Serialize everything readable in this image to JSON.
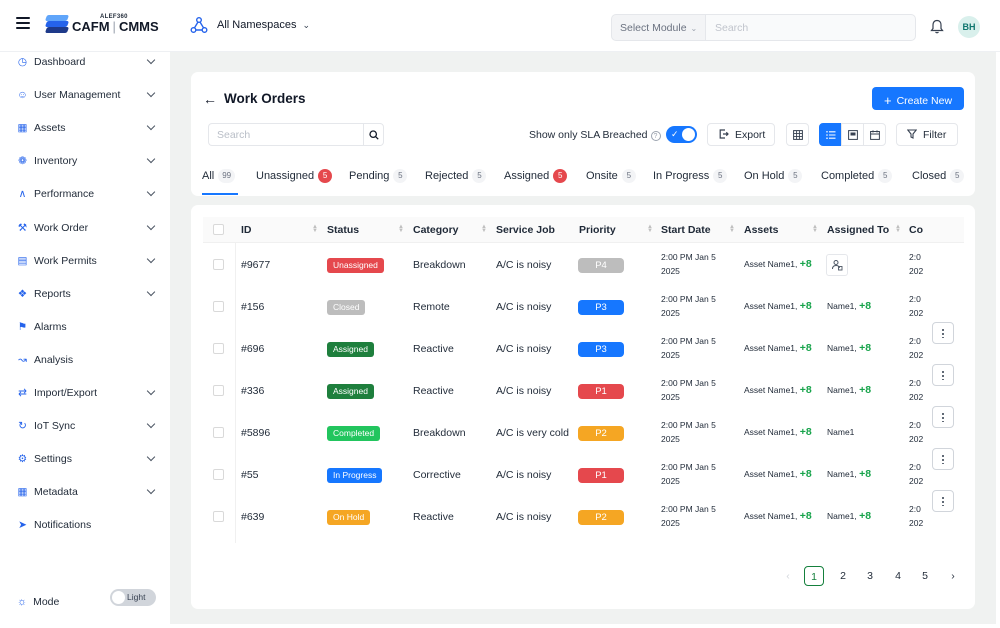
{
  "header": {
    "logo_small": "ALEF360",
    "logo_left": "CAFM",
    "logo_right": "CMMS",
    "namespace": "All Namespaces",
    "module_placeholder": "Select Module",
    "search_placeholder": "Search",
    "avatar": "BH"
  },
  "sidebar": {
    "items": [
      {
        "label": "Dashboard",
        "icon": "dashboard-icon",
        "chevron": true
      },
      {
        "label": "User Management",
        "icon": "user-icon",
        "chevron": true
      },
      {
        "label": "Assets",
        "icon": "grid-icon",
        "chevron": true
      },
      {
        "label": "Inventory",
        "icon": "inventory-icon",
        "chevron": true
      },
      {
        "label": "Performance",
        "icon": "performance-icon",
        "chevron": true
      },
      {
        "label": "Work Order",
        "icon": "tools-icon",
        "chevron": true
      },
      {
        "label": "Work Permits",
        "icon": "document-icon",
        "chevron": true
      },
      {
        "label": "Reports",
        "icon": "reports-icon",
        "chevron": true
      },
      {
        "label": "Alarms",
        "icon": "alarm-icon",
        "chevron": false
      },
      {
        "label": "Analysis",
        "icon": "analysis-icon",
        "chevron": false
      },
      {
        "label": "Import/Export",
        "icon": "import-export-icon",
        "chevron": true
      },
      {
        "label": "IoT Sync",
        "icon": "sync-icon",
        "chevron": true
      },
      {
        "label": "Settings",
        "icon": "gear-icon",
        "chevron": true
      },
      {
        "label": "Metadata",
        "icon": "metadata-icon",
        "chevron": true
      },
      {
        "label": "Notifications",
        "icon": "notification-icon",
        "chevron": false
      }
    ],
    "mode_label": "Mode",
    "mode_value": "Light"
  },
  "page": {
    "title": "Work Orders",
    "create_label": "Create New",
    "search_placeholder": "Search",
    "sla_label": "Show only SLA Breached",
    "export_label": "Export",
    "filter_label": "Filter"
  },
  "tabs": [
    {
      "label": "All",
      "count": "99",
      "highlight": false
    },
    {
      "label": "Unassigned",
      "count": "5",
      "highlight": true
    },
    {
      "label": "Pending",
      "count": "5",
      "highlight": false
    },
    {
      "label": "Rejected",
      "count": "5",
      "highlight": false
    },
    {
      "label": "Assigned",
      "count": "5",
      "highlight": true
    },
    {
      "label": "Onsite",
      "count": "5",
      "highlight": false
    },
    {
      "label": "In Progress",
      "count": "5",
      "highlight": false
    },
    {
      "label": "On Hold",
      "count": "5",
      "highlight": false
    },
    {
      "label": "Completed",
      "count": "5",
      "highlight": false
    },
    {
      "label": "Closed",
      "count": "5",
      "highlight": false
    }
  ],
  "table": {
    "columns": [
      "ID",
      "Status",
      "Category",
      "Service Job",
      "Priority",
      "Start Date",
      "Assets",
      "Assigned To",
      "Co"
    ],
    "rows": [
      {
        "id": "#9677",
        "status": "Unassigned",
        "status_color": "#e5484d",
        "category": "Breakdown",
        "job": "A/C is noisy",
        "priority": "P4",
        "priority_color": "#bdbdbd",
        "date1": "2:00 PM Jan 5",
        "date2": "2025",
        "asset": "Asset Name1,",
        "asset_more": "+8",
        "assigned": "",
        "assigned_more": "",
        "co1": "2:0",
        "co2": "202"
      },
      {
        "id": "#156",
        "status": "Closed",
        "status_color": "#bdbdbd",
        "category": "Remote",
        "job": "A/C is noisy",
        "priority": "P3",
        "priority_color": "#1677ff",
        "date1": "2:00 PM Jan 5",
        "date2": "2025",
        "asset": "Asset Name1,",
        "asset_more": "+8",
        "assigned": "Name1,",
        "assigned_more": "+8",
        "co1": "2:0",
        "co2": "202"
      },
      {
        "id": "#696",
        "status": "Assigned",
        "status_color": "#1e7f3d",
        "category": "Reactive",
        "job": "A/C is noisy",
        "priority": "P3",
        "priority_color": "#1677ff",
        "date1": "2:00 PM Jan 5",
        "date2": "2025",
        "asset": "Asset Name1,",
        "asset_more": "+8",
        "assigned": "Name1,",
        "assigned_more": "+8",
        "co1": "2:0",
        "co2": "202"
      },
      {
        "id": "#336",
        "status": "Assigned",
        "status_color": "#1e7f3d",
        "category": "Reactive",
        "job": "A/C is noisy",
        "priority": "P1",
        "priority_color": "#e5484d",
        "date1": "2:00 PM Jan 5",
        "date2": "2025",
        "asset": "Asset Name1,",
        "asset_more": "+8",
        "assigned": "Name1,",
        "assigned_more": "+8",
        "co1": "2:0",
        "co2": "202"
      },
      {
        "id": "#5896",
        "status": "Completed",
        "status_color": "#22c55e",
        "category": "Breakdown",
        "job": "A/C is very cold",
        "priority": "P2",
        "priority_color": "#f5a623",
        "date1": "2:00 PM Jan 5",
        "date2": "2025",
        "asset": "Asset Name1,",
        "asset_more": "+8",
        "assigned": "Name1",
        "assigned_more": "",
        "co1": "2:0",
        "co2": "202"
      },
      {
        "id": "#55",
        "status": "In Progress",
        "status_color": "#1677ff",
        "category": "Corrective",
        "job": "A/C is noisy",
        "priority": "P1",
        "priority_color": "#e5484d",
        "date1": "2:00 PM Jan 5",
        "date2": "2025",
        "asset": "Asset Name1,",
        "asset_more": "+8",
        "assigned": "Name1,",
        "assigned_more": "+8",
        "co1": "2:0",
        "co2": "202"
      },
      {
        "id": "#639",
        "status": "On Hold",
        "status_color": "#f5a623",
        "category": "Reactive",
        "job": "A/C is noisy",
        "priority": "P2",
        "priority_color": "#f5a623",
        "date1": "2:00 PM Jan 5",
        "date2": "2025",
        "asset": "Asset Name1,",
        "asset_more": "+8",
        "assigned": "Name1,",
        "assigned_more": "+8",
        "co1": "2:0",
        "co2": "202"
      }
    ]
  },
  "pagination": {
    "pages": [
      "1",
      "2",
      "3",
      "4",
      "5"
    ],
    "current": "1"
  },
  "colors": {
    "accent": "#1677ff",
    "sidebar_icon": "#2563eb",
    "plus_green": "#16a34a"
  }
}
